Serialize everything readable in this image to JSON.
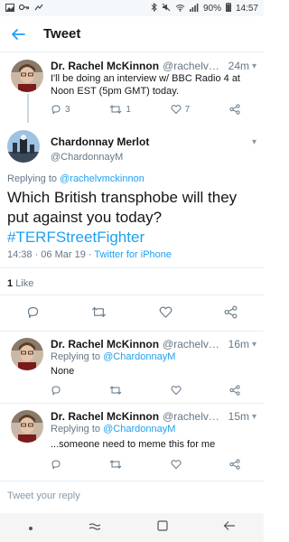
{
  "status_bar": {
    "battery": "90%",
    "clock": "14:57"
  },
  "app_bar": {
    "title": "Tweet"
  },
  "parent_tweet": {
    "author_name": "Dr. Rachel McKinnon",
    "handle": "@rachelvmc...",
    "time": "24m",
    "text": "I'll be doing an interview w/ BBC Radio 4 at Noon EST (5pm GMT) today.",
    "replies": "3",
    "retweets": "1",
    "likes": "7"
  },
  "main_tweet": {
    "author_name": "Chardonnay Merlot",
    "handle": "@ChardonnayM",
    "replying_to_label": "Replying to",
    "replying_to_handle": "@rachelvmckinnon",
    "text": "Which British transphobe will they put against you today?",
    "hashtag": "#TERFStreetFighter",
    "timestamp": "14:38 · 06 Mar 19 · ",
    "source": "Twitter for iPhone",
    "like_count": "1",
    "like_label": "Like"
  },
  "replies": [
    {
      "author_name": "Dr. Rachel McKinnon",
      "handle": "@rachelvmc...",
      "time": "16m",
      "replying_to_label": "Replying to",
      "replying_to_handle": "@ChardonnayM",
      "text": "None"
    },
    {
      "author_name": "Dr. Rachel McKinnon",
      "handle": "@rachelvmc...",
      "time": "15m",
      "replying_to_label": "Replying to",
      "replying_to_handle": "@ChardonnayM",
      "text": "...someone need to meme this for me"
    }
  ],
  "compose": {
    "placeholder": "Tweet your reply"
  },
  "colors": {
    "accent": "#1da1f2",
    "muted": "#657786",
    "text": "#14171a"
  }
}
